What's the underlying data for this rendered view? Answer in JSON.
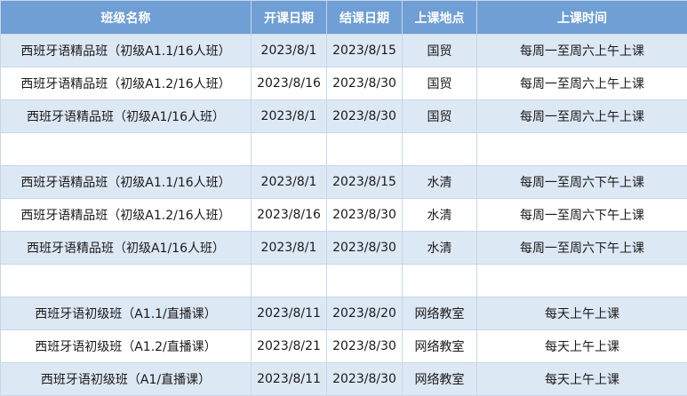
{
  "headers": [
    "班级名称",
    "开课日期",
    "结课日期",
    "上课地点",
    "上课时间"
  ],
  "rows": [
    [
      "西班牙语精品班（初级A1.1/16人班）",
      "2023/8/1",
      "2023/8/15",
      "国贸",
      "每周一至周六上午上课"
    ],
    [
      "西班牙语精品班（初级A1.2/16人班）",
      "2023/8/16",
      "2023/8/30",
      "国贸",
      "每周一至周六上午上课"
    ],
    [
      "西班牙语精品班（初级A1/16人班）",
      "2023/8/1",
      "2023/8/30",
      "国贸",
      "每周一至周六上午上课"
    ],
    [
      "",
      "",
      "",
      "",
      ""
    ],
    [
      "西班牙语精品班（初级A1.1/16人班）",
      "2023/8/1",
      "2023/8/15",
      "水清",
      "每周一至周六下午上课"
    ],
    [
      "西班牙语精品班（初级A1.2/16人班）",
      "2023/8/16",
      "2023/8/30",
      "水清",
      "每周一至周六下午上课"
    ],
    [
      "西班牙语精品班（初级A1/16人班）",
      "2023/8/1",
      "2023/8/30",
      "水清",
      "每周一至周六下午上课"
    ],
    [
      "",
      "",
      "",
      "",
      ""
    ],
    [
      "西班牙语初级班（A1.1/直播课）",
      "2023/8/11",
      "2023/8/20",
      "网络教室",
      "每天上午上课"
    ],
    [
      "西班牙语初级班（A1.2/直播课）",
      "2023/8/21",
      "2023/8/30",
      "网络教室",
      "每天上午上课"
    ],
    [
      "西班牙语初级班（A1/直播课）",
      "2023/8/11",
      "2023/8/30",
      "网络教室",
      "每天上午上课"
    ]
  ]
}
